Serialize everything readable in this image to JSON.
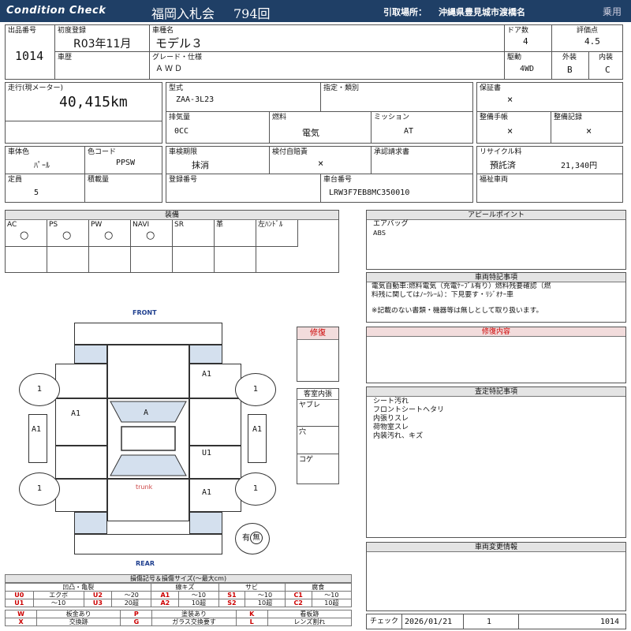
{
  "header": {
    "brand": "Condition Check",
    "auction": "福岡入札会",
    "lot_no": "794回",
    "pickup_label": "引取場所：",
    "pickup_place": "沖縄県豊見城市渡橋名",
    "category": "乗用"
  },
  "info": {
    "lot_label": "出品番号",
    "lot": "1014",
    "reg_label": "初度登録",
    "reg": "R03年11月",
    "name_label": "車種名",
    "name": "モデル３",
    "doors_label": "ドア数",
    "doors": "4",
    "score_label": "評価点",
    "score": "4.5",
    "history_label": "車歴",
    "grade_label": "グレード・仕様",
    "grade": "ＡＷＤ",
    "drive_label": "駆動",
    "drive": "4WD",
    "ext_label": "外装",
    "ext": "B",
    "int_label": "内装",
    "int": "C",
    "mileage_label": "走行(現メーター)",
    "mileage": "40,415km",
    "model_label": "型式",
    "model": "ZAA-3L23",
    "designation_label": "指定・類別",
    "warranty_label": "保証書",
    "warranty": "×",
    "displacement_label": "排気量",
    "displacement": "0CC",
    "fuel_label": "燃料",
    "fuel": "電気",
    "mission_label": "ミッション",
    "mission": "AT",
    "manual_label": "整備手帳",
    "manual": "×",
    "record_label": "整備記録",
    "record": "×",
    "color_label": "車体色",
    "color": "ﾊﾟｰﾙ",
    "color_code_label": "色コード",
    "color_code": "PPSW",
    "inspection_label": "車検期限",
    "inspection": "抹消",
    "insurance_label": "検付自賠責",
    "insurance": "×",
    "approval_label": "承認請求書",
    "recycle_label": "リサイクル料",
    "recycle_status": "預託済",
    "recycle_amount": "21,340円",
    "capacity_label": "定員",
    "capacity": "5",
    "load_label": "積載量",
    "plate_label": "登録番号",
    "vin_label": "車台番号",
    "vin": "LRW3F7EB8MC350010",
    "welfare_label": "福祉車両"
  },
  "equipment": {
    "title": "装備",
    "cols": [
      {
        "label": "AC",
        "value": "○"
      },
      {
        "label": "PS",
        "value": "○"
      },
      {
        "label": "PW",
        "value": "○"
      },
      {
        "label": "NAVI",
        "value": "○"
      },
      {
        "label": "SR",
        "value": ""
      },
      {
        "label": "革",
        "value": ""
      },
      {
        "label": "左ﾊﾝﾄﾞﾙ",
        "value": ""
      }
    ]
  },
  "appeal": {
    "title": "アピールポイント",
    "lines": [
      "エアバッグ",
      "ABS"
    ]
  },
  "special": {
    "title": "車両特記事項",
    "lines": [
      "電気自動車:燃料電気（充電ｹｰﾌﾞﾙ有り）燃料残要確認（燃",
      "料残に関してはﾉｰｸﾚｰﾑ）：下見要す・ﾘｼﾞｵﾅｰ車",
      "",
      "※記載のない書類・機器等は無しとして取り扱います。"
    ]
  },
  "repair": {
    "label": "修復",
    "title": "修復内容"
  },
  "cabin": {
    "title": "客室内張",
    "tear": "ヤブレ",
    "hole": "穴",
    "burn": "コゲ"
  },
  "assessment": {
    "title": "査定特記事項",
    "lines": [
      "シート汚れ",
      "フロントシートヘタリ",
      "内張りスレ",
      "荷物室スレ",
      "内装汚れ、キズ"
    ]
  },
  "change": {
    "title": "車両変更情報"
  },
  "diagram": {
    "front": "FRONT",
    "rear": "REAR",
    "trunk": "trunk",
    "marks": {
      "fl_tire": "1",
      "fr_tire": "1",
      "rl_tire": "1",
      "rr_tire": "1",
      "r_front_fender": "A1",
      "l_front_door": "A1",
      "l_mirror": "A1",
      "windshield": "A",
      "r_mirror": "A1",
      "r_rear_door": "U1",
      "r_rear_fender": "A1",
      "spare": "有",
      "spare_mark": "無"
    }
  },
  "legend": {
    "title": "損傷記号＆損傷サイズ(～最大cm)",
    "groups": [
      "凹凸・亀裂",
      "線キズ",
      "サビ",
      "腐食"
    ],
    "row1": [
      {
        "code": "U0",
        "desc": "エクボ"
      },
      {
        "code": "U2",
        "desc": "～20"
      },
      {
        "code": "A1",
        "desc": "～10"
      },
      {
        "code": "S1",
        "desc": "～10"
      },
      {
        "code": "C1",
        "desc": "～10"
      }
    ],
    "row2": [
      {
        "code": "U1",
        "desc": "～10"
      },
      {
        "code": "U3",
        "desc": "20超"
      },
      {
        "code": "A2",
        "desc": "10超"
      },
      {
        "code": "S2",
        "desc": "10超"
      },
      {
        "code": "C2",
        "desc": "10超"
      }
    ],
    "row3": [
      {
        "code": "W",
        "desc": "板金あり"
      },
      {
        "code": "P",
        "desc": "塗装あり"
      },
      {
        "code": "K",
        "desc": "看板跡"
      }
    ],
    "row4": [
      {
        "code": "X",
        "desc": "交換跡"
      },
      {
        "code": "G",
        "desc": "ガラス交換要す"
      },
      {
        "code": "L",
        "desc": "レンズ割れ"
      }
    ]
  },
  "check": {
    "label": "チェック",
    "date": "2026/01/21",
    "count": "1",
    "lot": "1014"
  }
}
